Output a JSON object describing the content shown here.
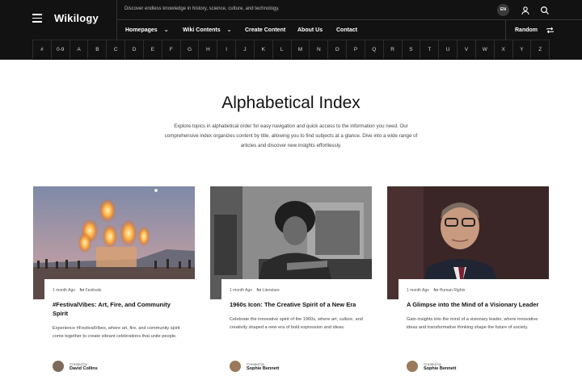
{
  "header": {
    "logo": "Wikilogy",
    "tagline": "Discover endless knowledge in history, science, culture, and technology.",
    "lang": "EN",
    "nav": [
      {
        "label": "Homepages",
        "dropdown": true
      },
      {
        "label": "Wiki Contents",
        "dropdown": true
      },
      {
        "label": "Create Content",
        "dropdown": false
      },
      {
        "label": "About Us",
        "dropdown": false
      },
      {
        "label": "Contact",
        "dropdown": false
      }
    ],
    "random_label": "Random"
  },
  "alphabet": [
    "#",
    "0-9",
    "A",
    "B",
    "C",
    "D",
    "E",
    "F",
    "G",
    "H",
    "I",
    "J",
    "K",
    "L",
    "M",
    "N",
    "O",
    "P",
    "Q",
    "R",
    "S",
    "T",
    "U",
    "V",
    "W",
    "X",
    "Y",
    "Z"
  ],
  "hero": {
    "title": "Alphabetical Index",
    "description": "Explore topics in alphabetical order for easy navigation and quick access to the information you need. Our comprehensive index organizes content by title, allowing you to find subjects at a glance. Dive into a wide range of articles and discover new insights effortlessly."
  },
  "cards": [
    {
      "time": "1 month Ago",
      "for_label": "for",
      "category": "Festivals",
      "title": "#FestivalVibes: Art, Fire, and Community Spirit",
      "excerpt": "Experience #FestivalVibes, where art, fire, and community spirit come together to create vibrant celebrations that unite people.",
      "created_by": "Created by",
      "author": "David Collins"
    },
    {
      "time": "1 month Ago",
      "for_label": "for",
      "category": "Literature",
      "title": "1960s Icon: The Creative Spirit of a New Era",
      "excerpt": "Celebrate the innovative spirit of the 1960s, where art, culture, and creativity shaped a new era of bold expression and ideas.",
      "created_by": "Created by",
      "author": "Sophie Bennett"
    },
    {
      "time": "1 month Ago",
      "for_label": "for",
      "category": "Human Rights",
      "title": "A Glimpse into the Mind of a Visionary Leader",
      "excerpt": "Gain insights into the mind of a visionary leader, where innovative ideas and transformative thinking shape the future of society.",
      "created_by": "Created by",
      "author": "Sophie Bennett"
    }
  ],
  "colors": {
    "header_bg": "#121212",
    "text": "#111111",
    "muted": "#444444"
  }
}
